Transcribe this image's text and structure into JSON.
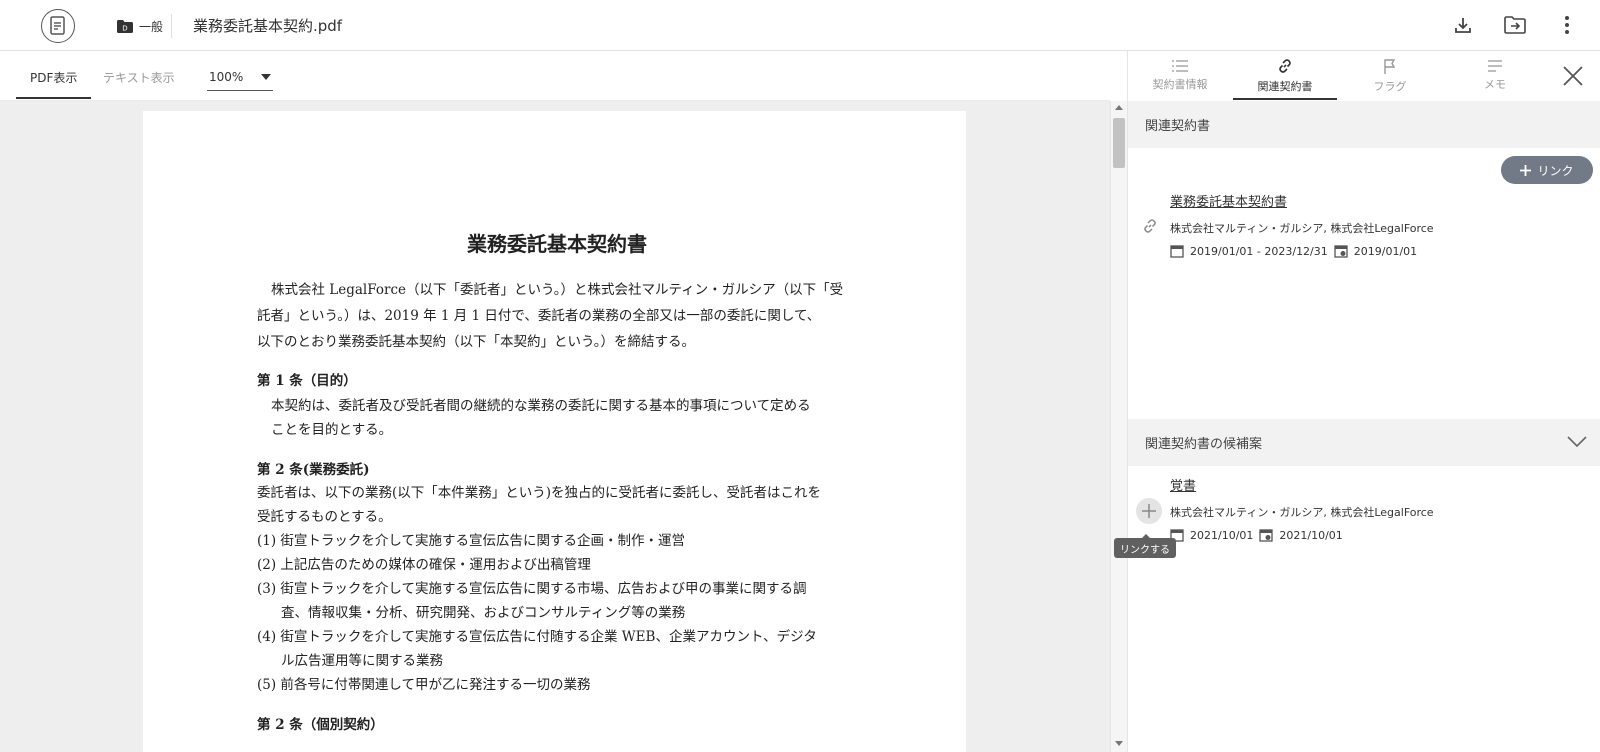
{
  "header": {
    "folder_label": "一般",
    "file_name": "業務委託基本契約.pdf"
  },
  "viewer": {
    "tab_pdf": "PDF表示",
    "tab_text": "テキスト表示",
    "zoom": "100%"
  },
  "document": {
    "title": "業務委託基本契約書",
    "lines": [
      "株式会社 LegalForce（以下「委託者」という。）と株式会社マルティン・ガルシア（以下「受",
      "託者」という。）は、2019 年 1 月 1 日付で、委託者の業務の全部又は一部の委託に関して、",
      "以下のとおり業務委託基本契約（以下「本契約」という。）を締結する。",
      "第 1 条（目的）",
      "本契約は、委託者及び受託者間の継続的な業務の委託に関する基本的事項について定める",
      "ことを目的とする。",
      "第 2 条(業務委託)",
      "委託者は、以下の業務(以下「本件業務」という)を独占的に受託者に委託し、受託者はこれを",
      "受託するものとする。",
      "(1)  街宣トラックを介して実施する宣伝広告に関する企画・制作・運営",
      "(2)  上記広告のための媒体の確保・運用および出稿管理",
      "(3)  街宣トラックを介して実施する宣伝広告に関する市場、広告および甲の事業に関する調",
      "査、情報収集・分析、研究開発、およびコンサルティング等の業務",
      "(4)  街宣トラックを介して実施する宣伝広告に付随する企業 WEB、企業アカウント、デジタ",
      "ル広告運用等に関する業務",
      "(5)  前各号に付帯関連して甲が乙に発注する一切の業務",
      "第 2 条（個別契約）"
    ]
  },
  "side_panel": {
    "tabs": [
      "契約書情報",
      "関連契約書",
      "フラグ",
      "メモ"
    ],
    "related_header": "関連契約書",
    "link_button": "リンク",
    "related": {
      "title": "業務委託基本契約書",
      "parties": "株式会社マルティン・ガルシア, 株式会社LegalForce",
      "period": "2019/01/01 - 2023/12/31",
      "date": "2019/01/01"
    },
    "candidates_header": "関連契約書の候補案",
    "candidate": {
      "title": "覚書",
      "parties": "株式会社マルティン・ガルシア, 株式会社LegalForce",
      "period": "2021/10/01",
      "date": "2021/10/01"
    },
    "tooltip": "リンクする"
  }
}
